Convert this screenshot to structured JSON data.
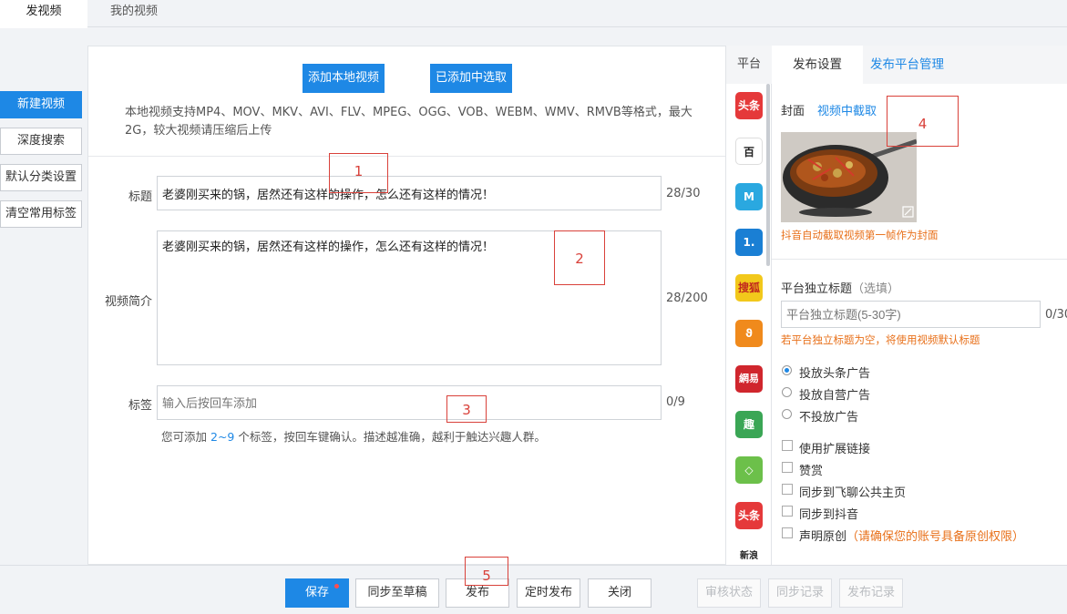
{
  "top_tabs": [
    "发视频",
    "我的视频"
  ],
  "sidebar": {
    "items": [
      "新建视频",
      "深度搜索",
      "默认分类设置",
      "清空常用标签"
    ]
  },
  "upload": {
    "add_local_label": "添加本地视频",
    "select_added_label": "已添加中选取",
    "formats_note": "本地视频支持MP4、MOV、MKV、AVI、FLV、MPEG、OGG、VOB、WEBM、WMV、RMVB等格式，最大2G，较大视频请压缩后上传"
  },
  "form": {
    "title_label": "标题",
    "title_value": "老婆刚买来的锅，居然还有这样的操作，怎么还有这样的情况！",
    "title_count": "28/30",
    "intro_label": "视频简介",
    "intro_value": "老婆刚买来的锅，居然还有这样的操作，怎么还有这样的情况！",
    "intro_count": "28/200",
    "tags_label": "标签",
    "tags_placeholder": "输入后按回车添加",
    "tags_count": "0/9",
    "tags_hint_pre": "您可添加",
    "tags_hint_range": "2~9",
    "tags_hint_post": "个标签，按回车键确认。描述越准确，越利于触达兴趣人群。"
  },
  "annotations": [
    "1",
    "2",
    "3",
    "4",
    "5"
  ],
  "platforms": {
    "header": "平台",
    "items": [
      {
        "name": "头条",
        "color": "#e5393a"
      },
      {
        "name": "百",
        "color": "#ffffff"
      },
      {
        "name": "M",
        "color": "#2aa8e0"
      },
      {
        "name": "1.",
        "color": "#1a7fd4"
      },
      {
        "name": "搜狐",
        "color": "#f2c81b"
      },
      {
        "name": "ϑ",
        "color": "#f08a1c"
      },
      {
        "name": "網易",
        "color": "#d0262d"
      },
      {
        "name": "趣",
        "color": "#3aa655"
      },
      {
        "name": "◇",
        "color": "#6cc04a"
      },
      {
        "name": "头条",
        "color": "#e5393a"
      },
      {
        "name": "新浪",
        "color": "#ffffff"
      }
    ]
  },
  "settings": {
    "tab_active": "发布设置",
    "tab_manage": "发布平台管理",
    "cover_label": "封面",
    "cover_link": "视频中截取",
    "cover_note": "抖音自动截取视频第一帧作为封面",
    "independent_title_label": "平台独立标题",
    "independent_title_optional": "（选填）",
    "independent_title_placeholder": "平台独立标题(5-30字)",
    "independent_title_count": "0/30",
    "independent_title_note": "若平台独立标题为空，将使用视频默认标题",
    "ad_options": [
      "投放头条广告",
      "投放自营广告",
      "不投放广告"
    ],
    "checkboxes": [
      "使用扩展链接",
      "赞赏",
      "同步到飞聊公共主页",
      "同步到抖音",
      "声明原创"
    ],
    "original_note": "（请确保您的账号具备原创权限）"
  },
  "bottom": {
    "save": "保存",
    "sync_draft": "同步至草稿",
    "publish": "发布",
    "scheduled_publish": "定时发布",
    "close": "关闭",
    "review_status": "审核状态",
    "sync_record": "同步记录",
    "publish_record": "发布记录"
  },
  "colors": {
    "primary": "#1e88e5",
    "warning": "#e8701a",
    "annotation": "#d9413a"
  }
}
